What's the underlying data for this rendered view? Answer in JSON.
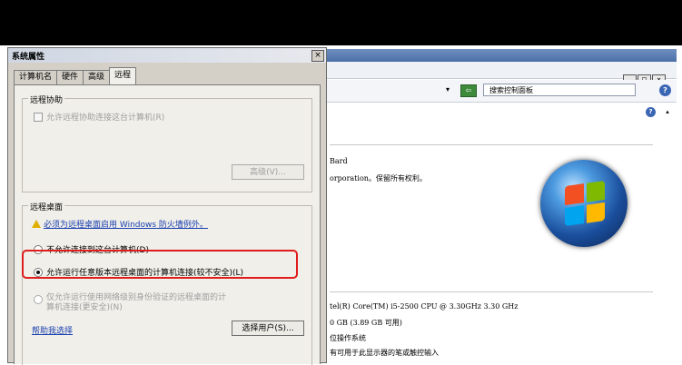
{
  "dialog": {
    "title": "系统属性",
    "close": "×",
    "tabs": [
      {
        "label": "计算机名"
      },
      {
        "label": "硬件"
      },
      {
        "label": "高级"
      },
      {
        "label": "远程"
      }
    ],
    "remote_assist": {
      "title": "远程协助",
      "checkbox_label": "允许远程协助连接这台计算机(R)",
      "advanced_button": "高级(V)..."
    },
    "remote_desktop": {
      "title": "远程桌面",
      "warning_link": "必须为远程桌面启用 Windows 防火墙例外。",
      "options": [
        {
          "label": "不允许连接到这台计算机(D)",
          "selected": false
        },
        {
          "label": "允许运行任意版本远程桌面的计算机连接(较不安全)(L)",
          "selected": true
        },
        {
          "label": "仅允许运行使用网络级别身份验证的远程桌面的计\n算机连接(更安全)(N)",
          "selected": false
        }
      ],
      "help_link": "帮助我选择",
      "select_users_button": "选择用户(S)..."
    }
  },
  "background_window": {
    "controls": {
      "minimize": "_",
      "maximize": "□",
      "close": "×"
    },
    "address_dropdown": "▾",
    "go": "⇦",
    "search_placeholder": "搜索控制面板",
    "help": "?",
    "scroll_up": "▴",
    "text_lines": [
      "Bard",
      "orporation。保留所有权利。"
    ],
    "system_lines": [
      "tel(R) Core(TM) i5-2500 CPU @ 3.30GHz   3.30 GHz",
      "0 GB (3.89 GB 可用)",
      "位操作系统",
      "有可用于此显示器的笔或触控输入"
    ]
  },
  "colors": {
    "highlight": "#e01c1c",
    "link": "#1a3fb0",
    "top_bar": "#000000"
  }
}
